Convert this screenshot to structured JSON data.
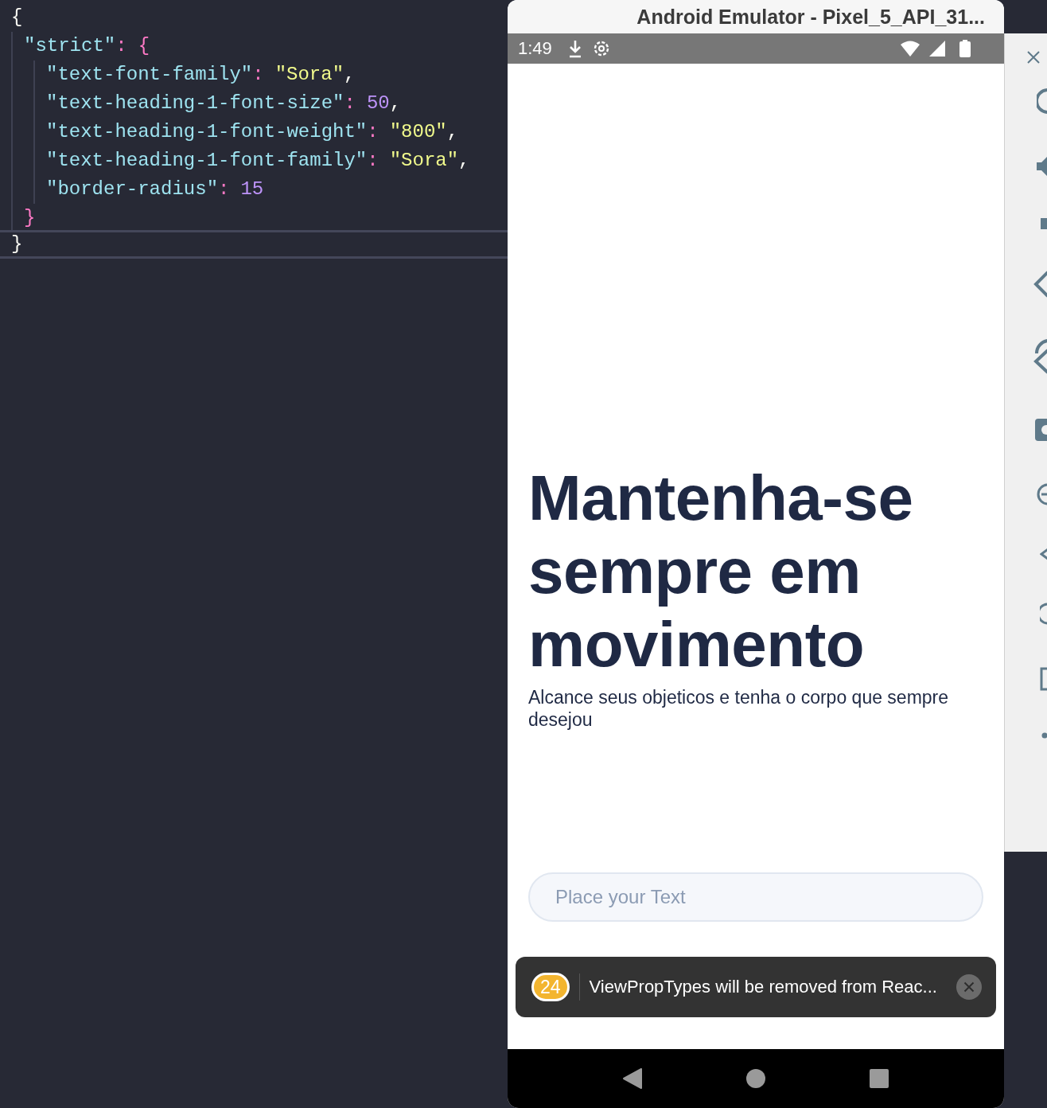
{
  "editor": {
    "lines": [
      {
        "tokens": [
          {
            "kind": "punct",
            "text": "{"
          }
        ],
        "children": [
          {
            "tokens": [
              {
                "kind": "key",
                "text": "\"strict\""
              },
              {
                "kind": "colon",
                "text": ":"
              },
              {
                "kind": "brace",
                "text": "{"
              }
            ],
            "children": [
              {
                "tokens": [
                  {
                    "kind": "key",
                    "text": "\"text-font-family\""
                  },
                  {
                    "kind": "colon",
                    "text": ":"
                  },
                  {
                    "kind": "string",
                    "text": "\"Sora\""
                  },
                  {
                    "kind": "punct",
                    "text": ","
                  }
                ]
              },
              {
                "tokens": [
                  {
                    "kind": "key",
                    "text": "\"text-heading-1-font-size\""
                  },
                  {
                    "kind": "colon",
                    "text": ":"
                  },
                  {
                    "kind": "number",
                    "text": "50"
                  },
                  {
                    "kind": "punct",
                    "text": ","
                  }
                ]
              },
              {
                "tokens": [
                  {
                    "kind": "key",
                    "text": "\"text-heading-1-font-weight\""
                  },
                  {
                    "kind": "colon",
                    "text": ":"
                  },
                  {
                    "kind": "string",
                    "text": "\"800\""
                  },
                  {
                    "kind": "punct",
                    "text": ","
                  }
                ]
              },
              {
                "tokens": [
                  {
                    "kind": "key",
                    "text": "\"text-heading-1-font-family\""
                  },
                  {
                    "kind": "colon",
                    "text": ":"
                  },
                  {
                    "kind": "string",
                    "text": "\"Sora\""
                  },
                  {
                    "kind": "punct",
                    "text": ","
                  }
                ]
              },
              {
                "tokens": [
                  {
                    "kind": "key",
                    "text": "\"border-radius\""
                  },
                  {
                    "kind": "colon",
                    "text": ":"
                  },
                  {
                    "kind": "number",
                    "text": "15"
                  }
                ]
              }
            ]
          },
          {
            "tokens": [
              {
                "kind": "brace",
                "text": "}"
              }
            ]
          }
        ]
      },
      {
        "tokens": [
          {
            "kind": "punct",
            "text": "}"
          }
        ],
        "current": true
      }
    ]
  },
  "emulator": {
    "title": "Android Emulator - Pixel_5_API_31...",
    "status_bar": {
      "time": "1:49"
    },
    "screen": {
      "heading": "Mantenha-se sempre em movimento",
      "subtitle": "Alcance seus objeticos e tenha o corpo que sempre desejou",
      "input": {
        "placeholder": "Place your Text"
      }
    },
    "toast": {
      "count": "24",
      "message": "ViewPropTypes will be removed from Reac..."
    }
  }
}
